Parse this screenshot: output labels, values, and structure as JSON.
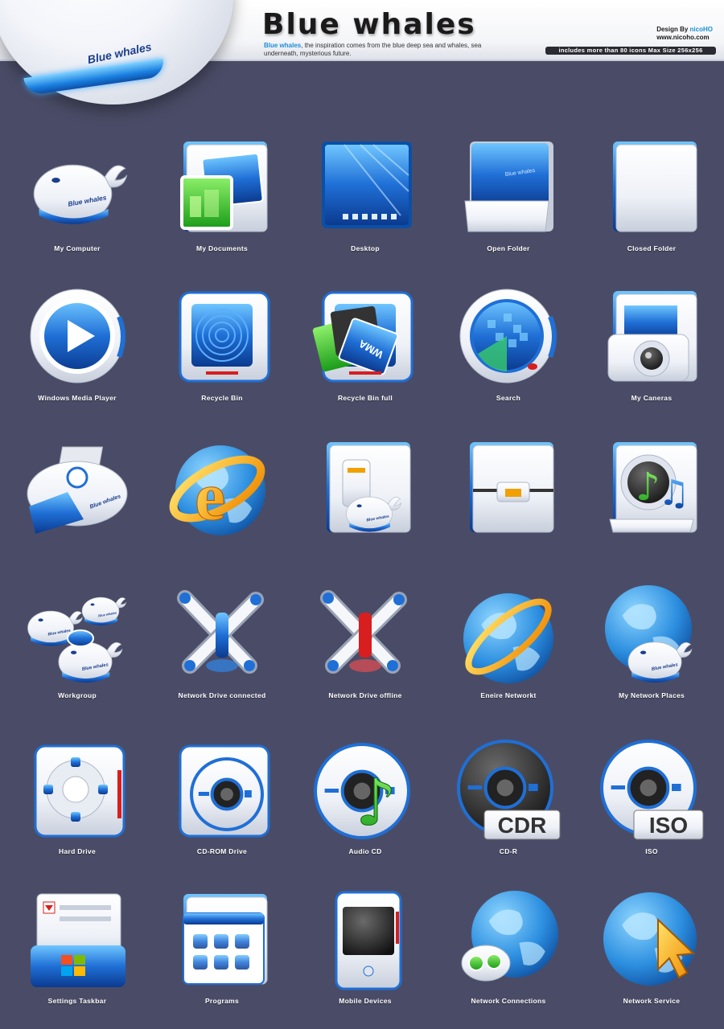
{
  "header": {
    "title": "Blue whales",
    "subtitle_highlight": "Blue whales",
    "subtitle_rest": ", the inspiration comes from the blue deep sea and whales, sea underneath, mysterious future.",
    "credit_prefix": "Design By",
    "credit_name": "nicoHO",
    "credit_site": "www.nicoho.com",
    "info": "includes more than 80 icons Max Size 256x256",
    "hero_text": "Blue whales"
  },
  "colors": {
    "background": "#4a4c67",
    "accent": "#1e8fd6",
    "header_bg": "#f4f5f8"
  },
  "icons": [
    {
      "label": "My Computer",
      "icon": "whale-computer-icon"
    },
    {
      "label": "My Documents",
      "icon": "documents-folder-icon"
    },
    {
      "label": "Desktop",
      "icon": "desktop-icon"
    },
    {
      "label": "Open Folder",
      "icon": "open-folder-icon"
    },
    {
      "label": "Closed Folder",
      "icon": "closed-folder-icon"
    },
    {
      "label": "Windows Media Player",
      "icon": "media-player-icon"
    },
    {
      "label": "Recycle Bin",
      "icon": "recycle-bin-icon"
    },
    {
      "label": "Recycle Bin full",
      "icon": "recycle-bin-full-icon"
    },
    {
      "label": "Search",
      "icon": "search-radar-icon"
    },
    {
      "label": "My Caneras",
      "icon": "camera-folder-icon"
    },
    {
      "label": "",
      "icon": "printer-icon"
    },
    {
      "label": "",
      "icon": "internet-explorer-icon"
    },
    {
      "label": "",
      "icon": "control-panel-folder-icon"
    },
    {
      "label": "",
      "icon": "locked-folder-icon"
    },
    {
      "label": "",
      "icon": "music-folder-icon"
    },
    {
      "label": "Workgroup",
      "icon": "workgroup-whales-icon"
    },
    {
      "label": "Network Drive connected",
      "icon": "network-drive-connected-icon"
    },
    {
      "label": "Network Drive offline",
      "icon": "network-drive-offline-icon"
    },
    {
      "label": "Eneire Networkt",
      "icon": "globe-ring-icon"
    },
    {
      "label": "My Network Places",
      "icon": "globe-whale-icon"
    },
    {
      "label": "Hard Drive",
      "icon": "hard-drive-icon"
    },
    {
      "label": "CD-ROM Drive",
      "icon": "cdrom-drive-icon"
    },
    {
      "label": "Audio CD",
      "icon": "audio-cd-icon"
    },
    {
      "label": "CD-R",
      "icon": "cdr-disc-icon",
      "badge": "CDR"
    },
    {
      "label": "ISO",
      "icon": "iso-disc-icon",
      "badge": "ISO"
    },
    {
      "label": "Settings Taskbar",
      "icon": "settings-taskbar-icon"
    },
    {
      "label": "Programs",
      "icon": "programs-window-icon"
    },
    {
      "label": "Mobile Devices",
      "icon": "mobile-device-icon"
    },
    {
      "label": "Network Connections",
      "icon": "network-connections-globe-icon"
    },
    {
      "label": "Network Service",
      "icon": "network-service-globe-icon"
    }
  ]
}
